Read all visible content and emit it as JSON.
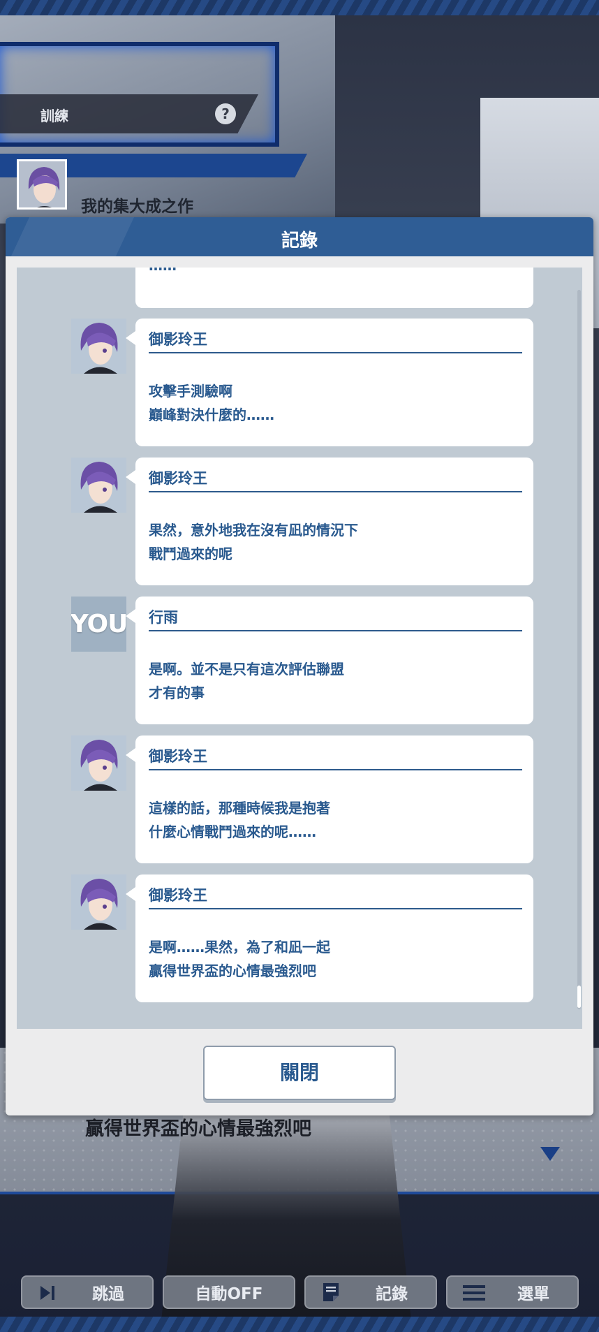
{
  "header": {
    "section_title": "訓練",
    "help_label": "?",
    "speaker_name": "我的集大成之作"
  },
  "modal": {
    "title": "記錄",
    "partial_text": "……",
    "entries": [
      {
        "speaker": "御影玲王",
        "avatar": "reo-avatar",
        "line1": "攻擊手測驗啊",
        "line2": "巔峰對決什麼的……"
      },
      {
        "speaker": "御影玲王",
        "avatar": "reo-avatar",
        "line1": "果然，意外地我在沒有凪的情況下",
        "line2": "戰鬥過來的呢"
      },
      {
        "speaker": "行雨",
        "avatar": "you-avatar",
        "avatar_text": "YOU",
        "line1": "是啊。並不是只有這次評估聯盟",
        "line2": "才有的事"
      },
      {
        "speaker": "御影玲王",
        "avatar": "reo-avatar",
        "line1": "這樣的話，那種時候我是抱著",
        "line2": "什麼心情戰鬥過來的呢……"
      },
      {
        "speaker": "御影玲王",
        "avatar": "reo-avatar",
        "line1": "是啊……果然，為了和凪一起",
        "line2": "贏得世界盃的心情最強烈吧"
      }
    ],
    "close_label": "關閉"
  },
  "background_dialogue": "贏得世界盃的心情最強烈吧",
  "toolbar": {
    "skip_label": "跳過",
    "auto_label": "自動OFF",
    "log_label": "記錄",
    "menu_label": "選單"
  },
  "colors": {
    "accent": "#2f5d95",
    "text_blue": "#2a5a8f",
    "log_bg": "#c0cad3"
  }
}
